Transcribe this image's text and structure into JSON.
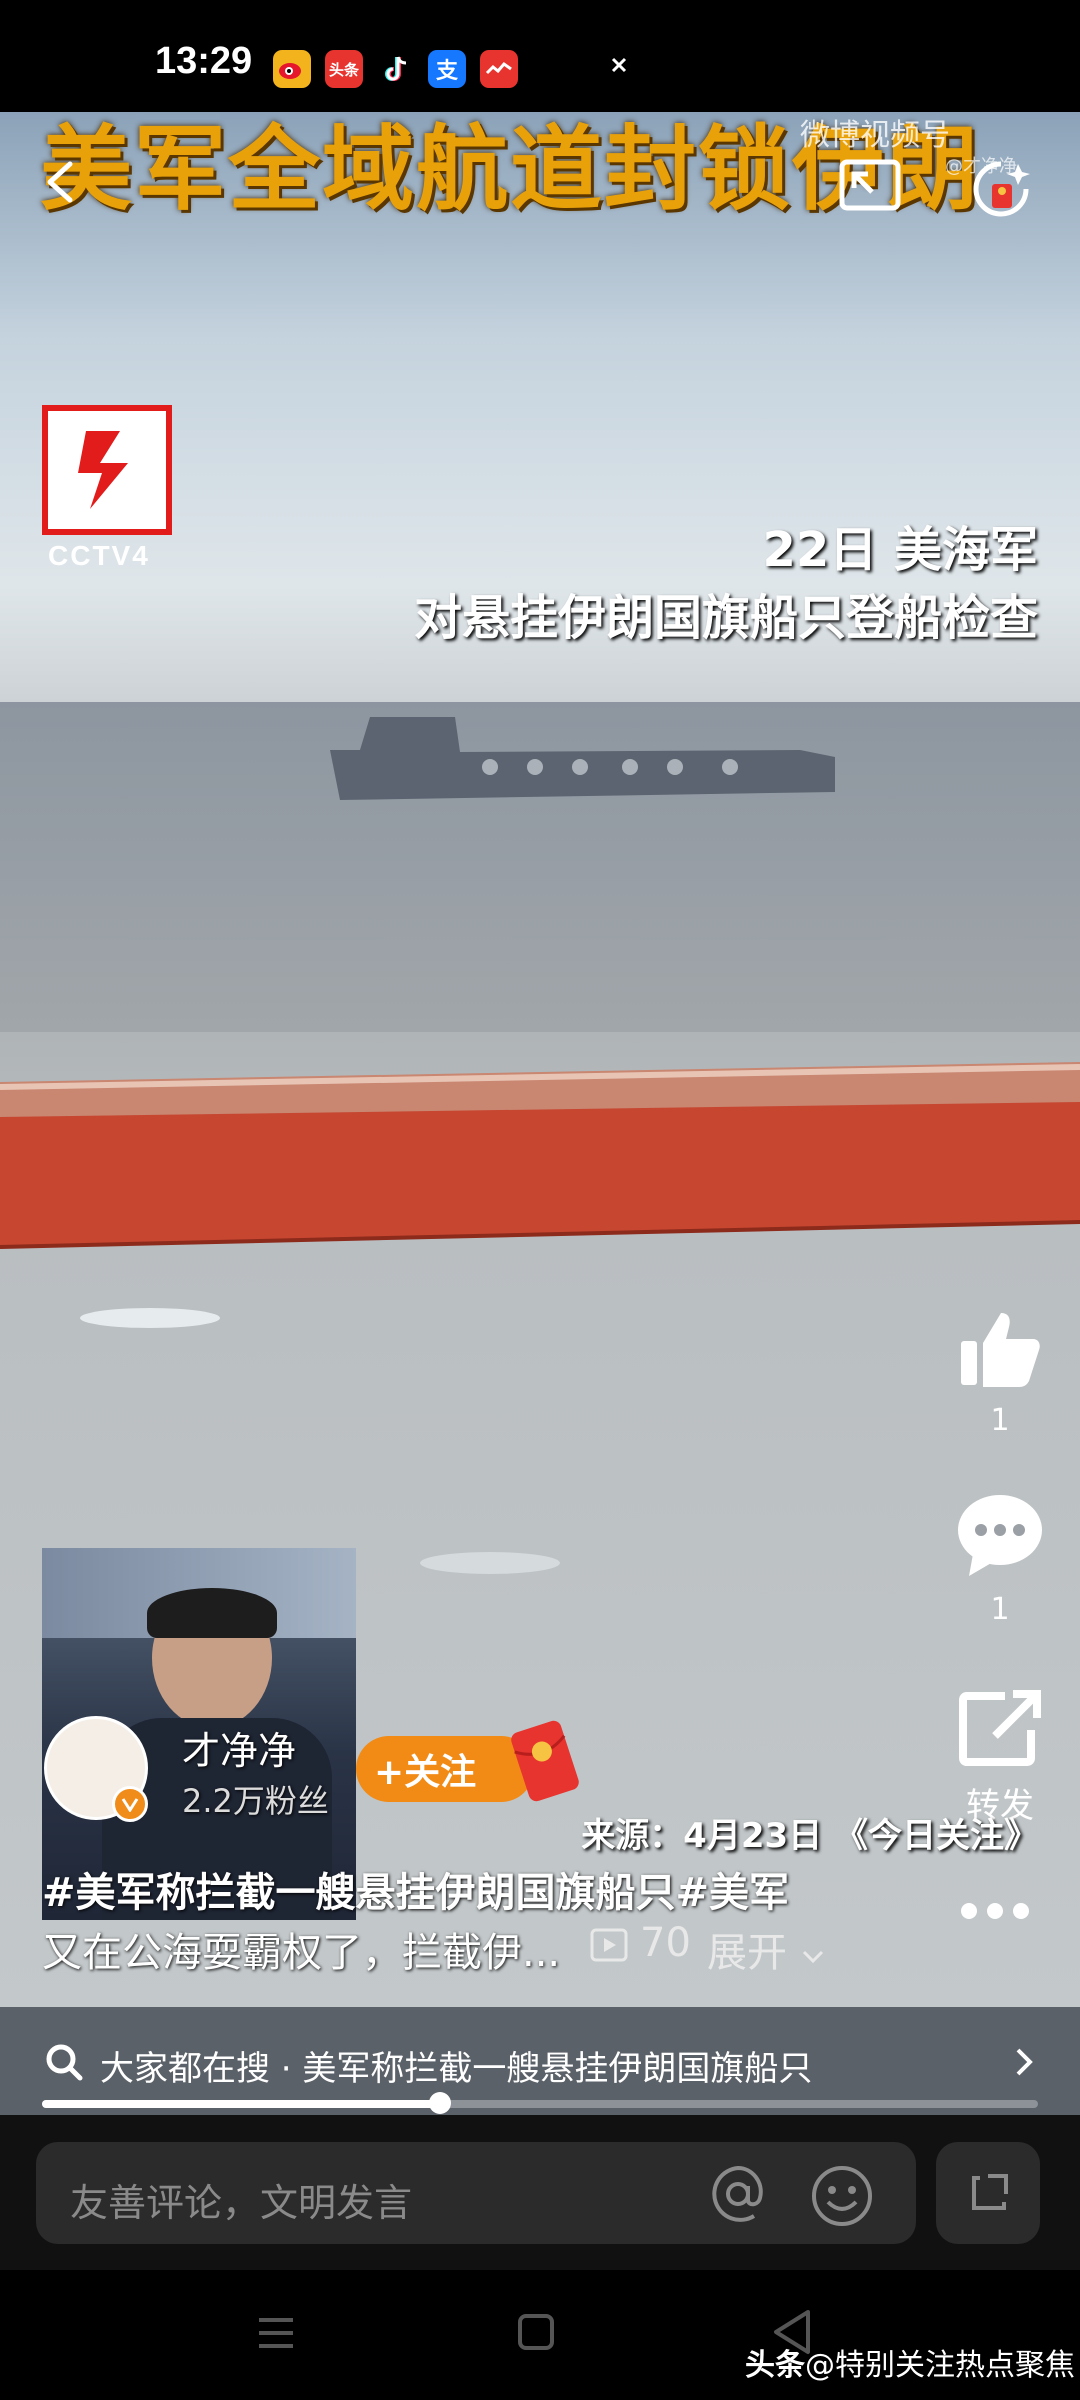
{
  "status_bar": {
    "time": "13:29",
    "app_icons": [
      "weibo-icon",
      "toutiao-icon",
      "tiktok-icon",
      "alipay-icon",
      "red-app-icon"
    ],
    "toutiao_label": "头条",
    "alipay_label": "支"
  },
  "video": {
    "headline": "美军全域航道封锁伊朗",
    "watermark": "微博视频号",
    "watermark_sub": "@才净净",
    "channel_logo_text": "CCTV4",
    "caption_line1": "22日 美海军",
    "caption_line2": "对悬挂伊朗国旗船只登船检查",
    "source": "来源：4月23日 《今日关注》"
  },
  "right_rail": {
    "like_count": "1",
    "comment_count": "1",
    "share_label": "转发"
  },
  "author": {
    "name": "才净净",
    "fans": "2.2万粉丝",
    "follow_label": "+关注"
  },
  "post": {
    "title": "#美军称拦截一艘悬挂伊朗国旗船只#美军",
    "description": "又在公海耍霸权了，拦截伊...",
    "plays": "70",
    "expand_label": "展开"
  },
  "search": {
    "text": "大家都在搜 · 美军称拦截一艘悬挂伊朗国旗船只"
  },
  "progress": {
    "fraction": 0.4
  },
  "comment": {
    "placeholder": "友善评论，文明发言"
  },
  "footer": {
    "brand": "头条",
    "account": "@特别关注热点聚焦"
  },
  "colors": {
    "accent": "#f28a16",
    "headline": "#e9a10a",
    "cctv_red": "#e21b1b"
  }
}
